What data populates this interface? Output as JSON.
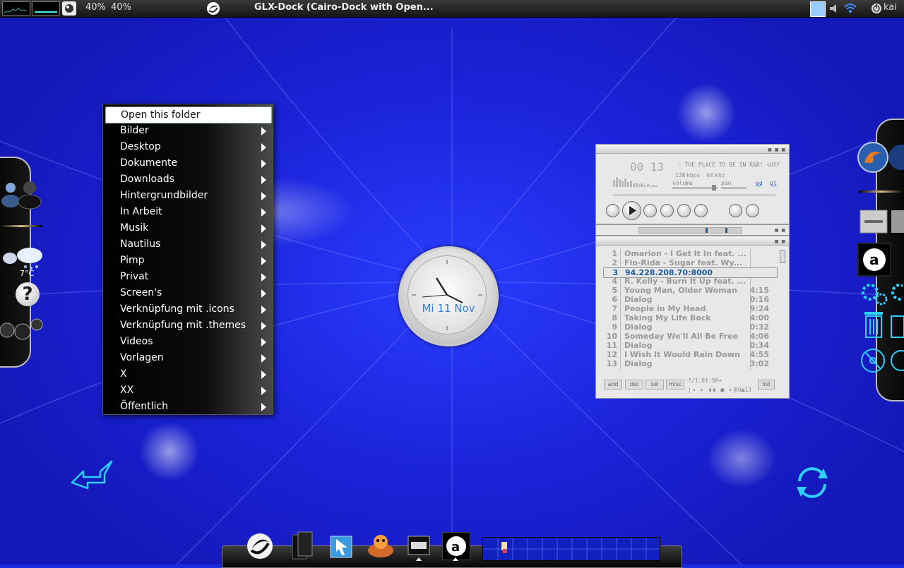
{
  "top_panel": {
    "cpu_text": "40%",
    "mem_text": "40%",
    "window_title": "GLX-Dock (Cairo-Dock with Open...",
    "user": "kai"
  },
  "context_menu": {
    "items": [
      {
        "label": "Open this folder",
        "submenu": false
      },
      {
        "label": "Bilder",
        "submenu": true
      },
      {
        "label": "Desktop",
        "submenu": true
      },
      {
        "label": "Dokumente",
        "submenu": true
      },
      {
        "label": "Downloads",
        "submenu": true
      },
      {
        "label": "Hintergrundbilder",
        "submenu": true
      },
      {
        "label": "In Arbeit",
        "submenu": true
      },
      {
        "label": "Musik",
        "submenu": true
      },
      {
        "label": "Nautilus",
        "submenu": true
      },
      {
        "label": "Pimp",
        "submenu": true
      },
      {
        "label": "Privat",
        "submenu": true
      },
      {
        "label": "Screen's",
        "submenu": true
      },
      {
        "label": "Verknüpfung mit .icons",
        "submenu": true
      },
      {
        "label": "Verknüpfung mit .themes",
        "submenu": true
      },
      {
        "label": "Videos",
        "submenu": true
      },
      {
        "label": "Vorlagen",
        "submenu": true
      },
      {
        "label": "X",
        "submenu": true
      },
      {
        "label": "XX",
        "submenu": true
      },
      {
        "label": "Öffentlich",
        "submenu": true
      }
    ]
  },
  "weather": {
    "temp": "7°C"
  },
  "clock": {
    "date": "Mi 11 Nov"
  },
  "player": {
    "time": "00 13",
    "marquee": "- THE PLACE TO BE IN R&B! <USF",
    "kbps": "128",
    "kbps_unit": "kbps",
    "khz": "44",
    "khz_unit": "khz",
    "volume_label": "volume",
    "pan_label": "pan",
    "eq_label": "eq",
    "pl_label": "pl",
    "playlist": [
      {
        "num": "1",
        "title": "Omarion - I Get It In feat. ...",
        "duration": ""
      },
      {
        "num": "2",
        "title": "Flo-Rida - Sugar feat. Wy...",
        "duration": ""
      },
      {
        "num": "3",
        "title": "94.228.208.70:8000",
        "duration": ""
      },
      {
        "num": "4",
        "title": "R. Kelly - Burn It Up feat. ...",
        "duration": ""
      },
      {
        "num": "5",
        "title": "Young Man, Older Woman",
        "duration": "4:15"
      },
      {
        "num": "6",
        "title": "Dialog",
        "duration": "0:16"
      },
      {
        "num": "7",
        "title": "People in My Head",
        "duration": "9:24"
      },
      {
        "num": "8",
        "title": "Taking My Life Back",
        "duration": "4:00"
      },
      {
        "num": "9",
        "title": "Dialog",
        "duration": "0:32"
      },
      {
        "num": "10",
        "title": "Someday We'll All Be Free",
        "duration": "4:06"
      },
      {
        "num": "11",
        "title": "Dialog",
        "duration": "0:34"
      },
      {
        "num": "12",
        "title": "I Wish It Would Rain Down",
        "duration": "4:55"
      },
      {
        "num": "13",
        "title": "Dialog",
        "duration": "3:02"
      }
    ],
    "selected_index": 2,
    "pl_buttons": {
      "add": "add",
      "del": "del",
      "sel": "sel",
      "misc": "misc",
      "list": "list"
    },
    "pl_status": "?/1:01:50+",
    "pl_time": "00 13"
  },
  "colors": {
    "desktop": "#1a2ae0",
    "menu_bg": "#000000",
    "accent_cyan": "#2fd0ff",
    "clock_date": "#3a7fd6",
    "playlist_selected": "#1c5c9c"
  }
}
